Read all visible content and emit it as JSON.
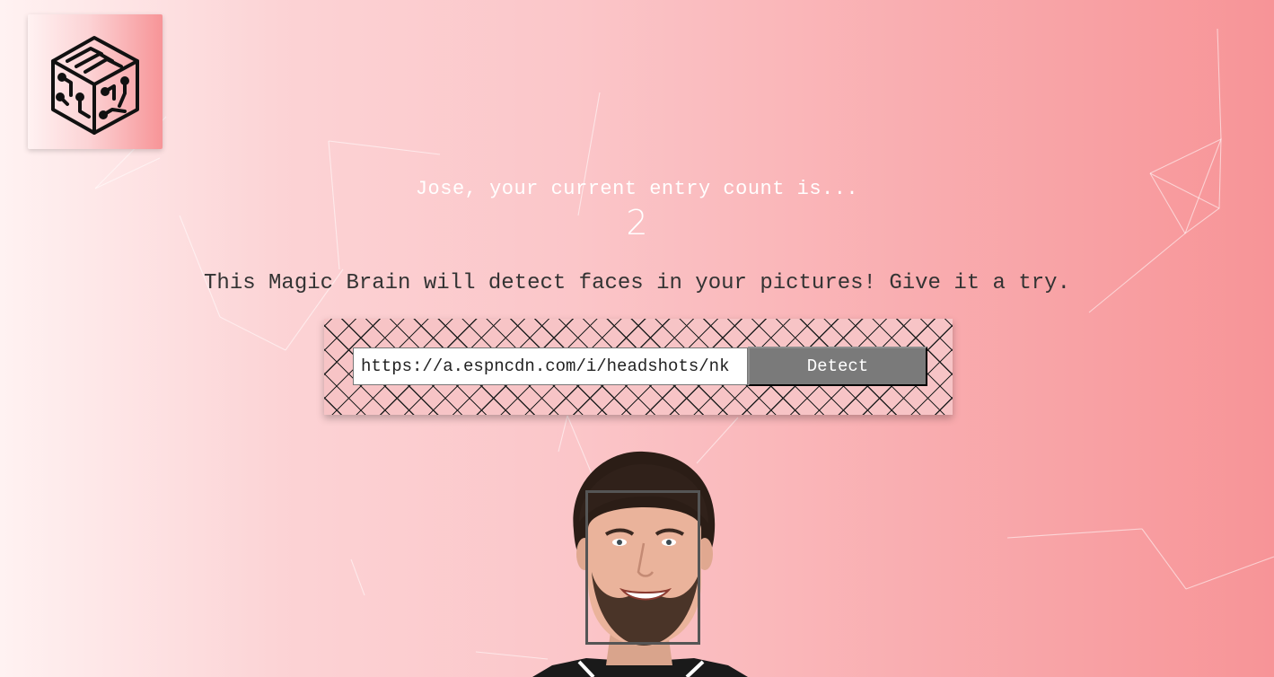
{
  "app": {
    "logo_icon": "brain-circuit-cube-icon"
  },
  "greeting": {
    "text": "Jose, your current entry count is...",
    "count": "2"
  },
  "tagline": "This Magic Brain will detect faces in your pictures! Give it a try.",
  "form": {
    "url_value": "https://a.espncdn.com/i/headshots/nk",
    "button_label": "Detect"
  },
  "result": {
    "image_icon": "detected-person-photo",
    "face_box_icon": "face-bounding-box"
  },
  "colors": {
    "gradient_left": "#fff2f2",
    "gradient_right": "#f79497",
    "button_bg": "#7a7a7a",
    "text_white": "#ffffff"
  }
}
